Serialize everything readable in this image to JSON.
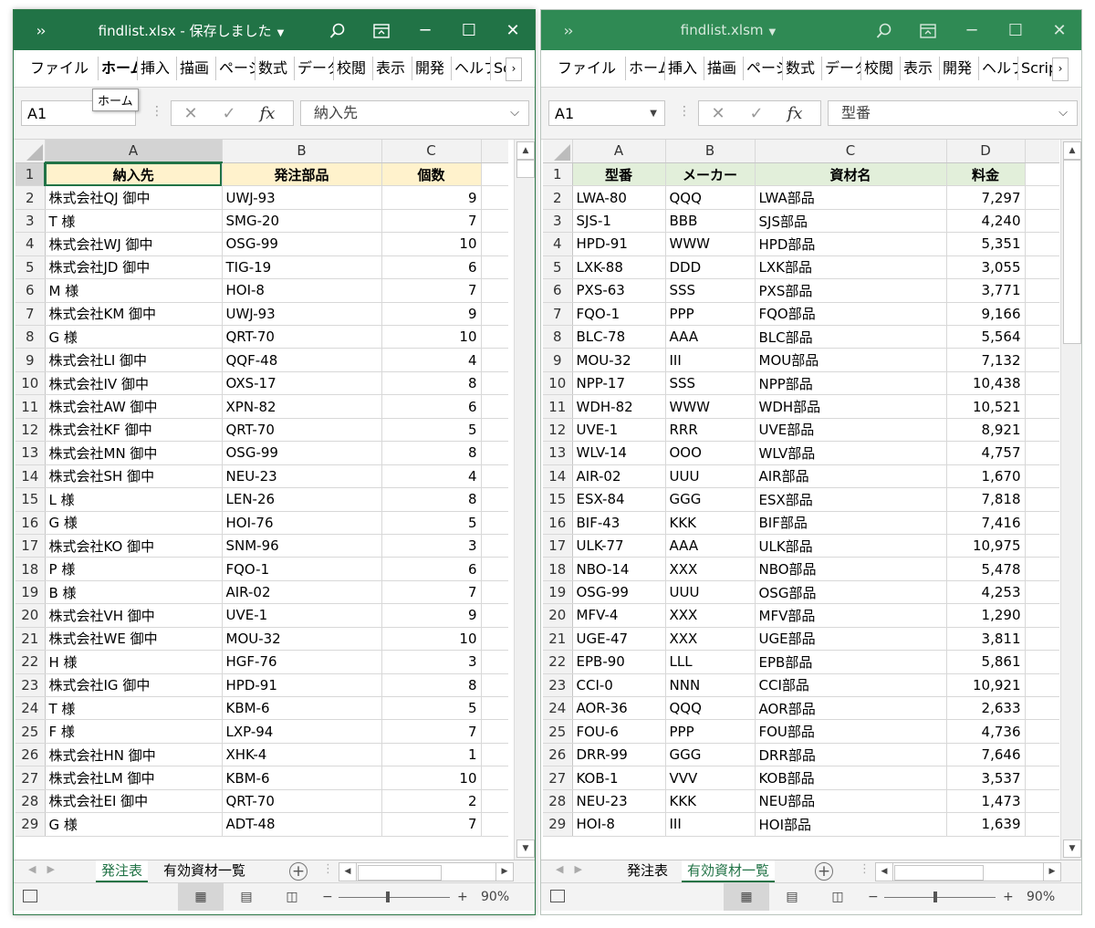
{
  "left": {
    "title": "findlist.xlsx - 保存しました",
    "ribbon_tabs": [
      "ファイル",
      "ホーム",
      "挿入",
      "描画",
      "ページ",
      "数式",
      "データ",
      "校閲",
      "表示",
      "開発",
      "ヘルプ",
      "Scri"
    ],
    "ribbon_active": "ホーム",
    "tooltip": "ホーム",
    "namebox": "A1",
    "formula": "納入先",
    "columns": [
      "A",
      "B",
      "C"
    ],
    "header": [
      "納入先",
      "発注部品",
      "個数"
    ],
    "rows": [
      [
        "株式会社QJ 御中",
        "UWJ-93",
        "9"
      ],
      [
        "T 様",
        "SMG-20",
        "7"
      ],
      [
        "株式会社WJ 御中",
        "OSG-99",
        "10"
      ],
      [
        "株式会社JD 御中",
        "TIG-19",
        "6"
      ],
      [
        "M 様",
        "HOI-8",
        "7"
      ],
      [
        "株式会社KM 御中",
        "UWJ-93",
        "9"
      ],
      [
        "G 様",
        "QRT-70",
        "10"
      ],
      [
        "株式会社LI 御中",
        "QQF-48",
        "4"
      ],
      [
        "株式会社IV 御中",
        "OXS-17",
        "8"
      ],
      [
        "株式会社AW 御中",
        "XPN-82",
        "6"
      ],
      [
        "株式会社KF 御中",
        "QRT-70",
        "5"
      ],
      [
        "株式会社MN 御中",
        "OSG-99",
        "8"
      ],
      [
        "株式会社SH 御中",
        "NEU-23",
        "4"
      ],
      [
        "L 様",
        "LEN-26",
        "8"
      ],
      [
        "G 様",
        "HOI-76",
        "5"
      ],
      [
        "株式会社KO 御中",
        "SNM-96",
        "3"
      ],
      [
        "P 様",
        "FQO-1",
        "6"
      ],
      [
        "B 様",
        "AIR-02",
        "7"
      ],
      [
        "株式会社VH 御中",
        "UVE-1",
        "9"
      ],
      [
        "株式会社WE 御中",
        "MOU-32",
        "10"
      ],
      [
        "H 様",
        "HGF-76",
        "3"
      ],
      [
        "株式会社IG 御中",
        "HPD-91",
        "8"
      ],
      [
        "T 様",
        "KBM-6",
        "5"
      ],
      [
        "F 様",
        "LXP-94",
        "7"
      ],
      [
        "株式会社HN 御中",
        "XHK-4",
        "1"
      ],
      [
        "株式会社LM 御中",
        "KBM-6",
        "10"
      ],
      [
        "株式会社EI 御中",
        "QRT-70",
        "2"
      ],
      [
        "G 様",
        "ADT-48",
        "7"
      ]
    ],
    "sheet_tabs": [
      "発注表",
      "有効資材一覧"
    ],
    "active_sheet": "発注表",
    "zoom": "90%"
  },
  "right": {
    "title": "findlist.xlsm",
    "ribbon_tabs": [
      "ファイル",
      "ホーム",
      "挿入",
      "描画",
      "ページ",
      "数式",
      "データ",
      "校閲",
      "表示",
      "開発",
      "ヘルプ",
      "Scrip"
    ],
    "namebox": "A1",
    "formula": "型番",
    "columns": [
      "A",
      "B",
      "C",
      "D"
    ],
    "header": [
      "型番",
      "メーカー",
      "資材名",
      "料金"
    ],
    "rows": [
      [
        "LWA-80",
        "QQQ",
        "LWA部品",
        "7,297"
      ],
      [
        "SJS-1",
        "BBB",
        "SJS部品",
        "4,240"
      ],
      [
        "HPD-91",
        "WWW",
        "HPD部品",
        "5,351"
      ],
      [
        "LXK-88",
        "DDD",
        "LXK部品",
        "3,055"
      ],
      [
        "PXS-63",
        "SSS",
        "PXS部品",
        "3,771"
      ],
      [
        "FQO-1",
        "PPP",
        "FQO部品",
        "9,166"
      ],
      [
        "BLC-78",
        "AAA",
        "BLC部品",
        "5,564"
      ],
      [
        "MOU-32",
        "III",
        "MOU部品",
        "7,132"
      ],
      [
        "NPP-17",
        "SSS",
        "NPP部品",
        "10,438"
      ],
      [
        "WDH-82",
        "WWW",
        "WDH部品",
        "10,521"
      ],
      [
        "UVE-1",
        "RRR",
        "UVE部品",
        "8,921"
      ],
      [
        "WLV-14",
        "OOO",
        "WLV部品",
        "4,757"
      ],
      [
        "AIR-02",
        "UUU",
        "AIR部品",
        "1,670"
      ],
      [
        "ESX-84",
        "GGG",
        "ESX部品",
        "7,818"
      ],
      [
        "BIF-43",
        "KKK",
        "BIF部品",
        "7,416"
      ],
      [
        "ULK-77",
        "AAA",
        "ULK部品",
        "10,975"
      ],
      [
        "NBO-14",
        "XXX",
        "NBO部品",
        "5,478"
      ],
      [
        "OSG-99",
        "UUU",
        "OSG部品",
        "4,253"
      ],
      [
        "MFV-4",
        "XXX",
        "MFV部品",
        "1,290"
      ],
      [
        "UGE-47",
        "XXX",
        "UGE部品",
        "3,811"
      ],
      [
        "EPB-90",
        "LLL",
        "EPB部品",
        "5,861"
      ],
      [
        "CCI-0",
        "NNN",
        "CCI部品",
        "10,921"
      ],
      [
        "AOR-36",
        "QQQ",
        "AOR部品",
        "2,633"
      ],
      [
        "FOU-6",
        "PPP",
        "FOU部品",
        "4,736"
      ],
      [
        "DRR-99",
        "GGG",
        "DRR部品",
        "7,646"
      ],
      [
        "KOB-1",
        "VVV",
        "KOB部品",
        "3,537"
      ],
      [
        "NEU-23",
        "KKK",
        "NEU部品",
        "1,473"
      ],
      [
        "HOI-8",
        "III",
        "HOI部品",
        "1,639"
      ]
    ],
    "sheet_tabs": [
      "発注表",
      "有効資材一覧"
    ],
    "active_sheet": "有効資材一覧",
    "zoom": "90%"
  },
  "colors": {
    "excel_green": "#217346",
    "header_fill_left": "#fff2cc",
    "header_fill_right": "#e2efda"
  }
}
